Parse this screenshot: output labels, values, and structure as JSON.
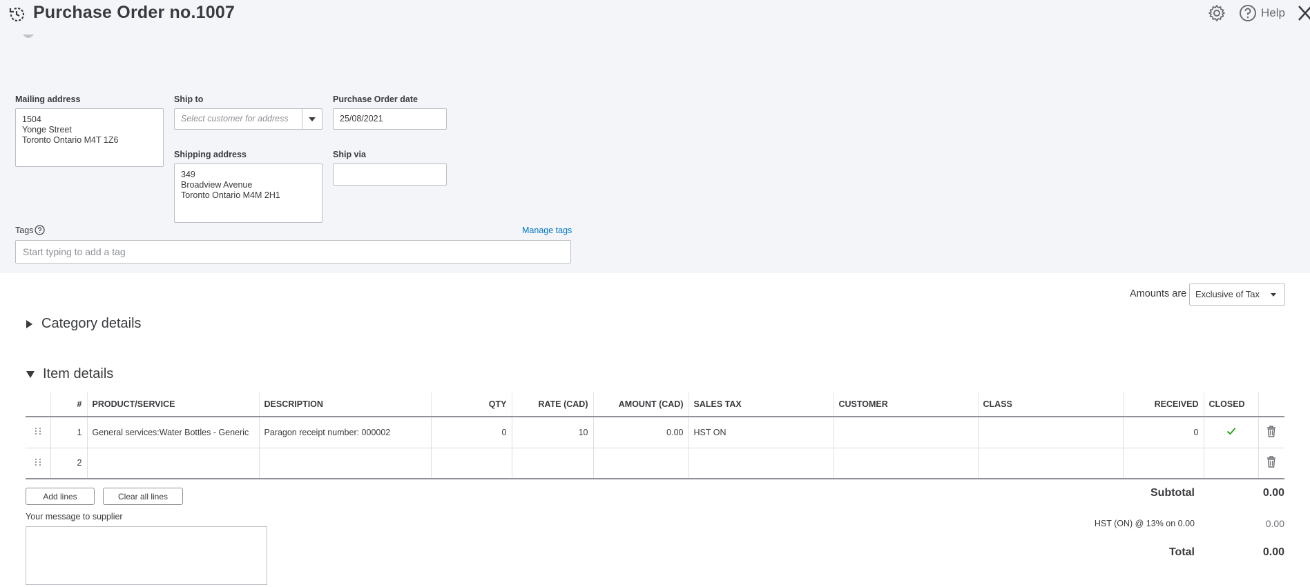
{
  "header": {
    "title": "Purchase Order no.1007",
    "help_label": "Help"
  },
  "form": {
    "mailing_address": {
      "label": "Mailing address",
      "value": "1504\nYonge Street\nToronto Ontario  M4T 1Z6"
    },
    "ship_to": {
      "label": "Ship to",
      "placeholder": "Select customer for address"
    },
    "po_date": {
      "label": "Purchase Order date",
      "value": "25/08/2021"
    },
    "shipping_address": {
      "label": "Shipping address",
      "value": "349\nBroadview Avenue\nToronto Ontario  M4M 2H1"
    },
    "ship_via": {
      "label": "Ship via",
      "value": ""
    },
    "tags": {
      "label": "Tags",
      "manage_label": "Manage tags",
      "placeholder": "Start typing to add a tag"
    }
  },
  "amounts": {
    "label": "Amounts are",
    "selected": "Exclusive of Tax"
  },
  "sections": {
    "category": "Category details",
    "item": "Item details"
  },
  "item_table": {
    "headers": [
      "",
      "#",
      "PRODUCT/SERVICE",
      "DESCRIPTION",
      "QTY",
      "RATE (CAD)",
      "AMOUNT (CAD)",
      "SALES TAX",
      "CUSTOMER",
      "CLASS",
      "RECEIVED",
      "CLOSED",
      ""
    ],
    "rows": [
      {
        "num": "1",
        "product": "General services:Water Bottles - Generic",
        "description": "Paragon receipt number: 000002",
        "qty": "0",
        "rate": "10",
        "amount": "0.00",
        "sales_tax": "HST ON",
        "customer": "",
        "class": "",
        "received": "0",
        "closed": true
      },
      {
        "num": "2",
        "product": "",
        "description": "",
        "qty": "",
        "rate": "",
        "amount": "",
        "sales_tax": "",
        "customer": "",
        "class": "",
        "received": "",
        "closed": false
      }
    ]
  },
  "buttons": {
    "add_lines": "Add lines",
    "clear_lines": "Clear all lines"
  },
  "message": {
    "label": "Your message to supplier",
    "value": ""
  },
  "totals": {
    "subtotal_label": "Subtotal",
    "subtotal_value": "0.00",
    "tax_label": "HST (ON) @ 13% on 0.00",
    "tax_value": "0.00",
    "total_label": "Total",
    "total_value": "0.00"
  },
  "colors": {
    "background_top": "#f4f5f8",
    "link": "#0077c5",
    "check": "#2ca01c",
    "text": "#393a3d"
  }
}
